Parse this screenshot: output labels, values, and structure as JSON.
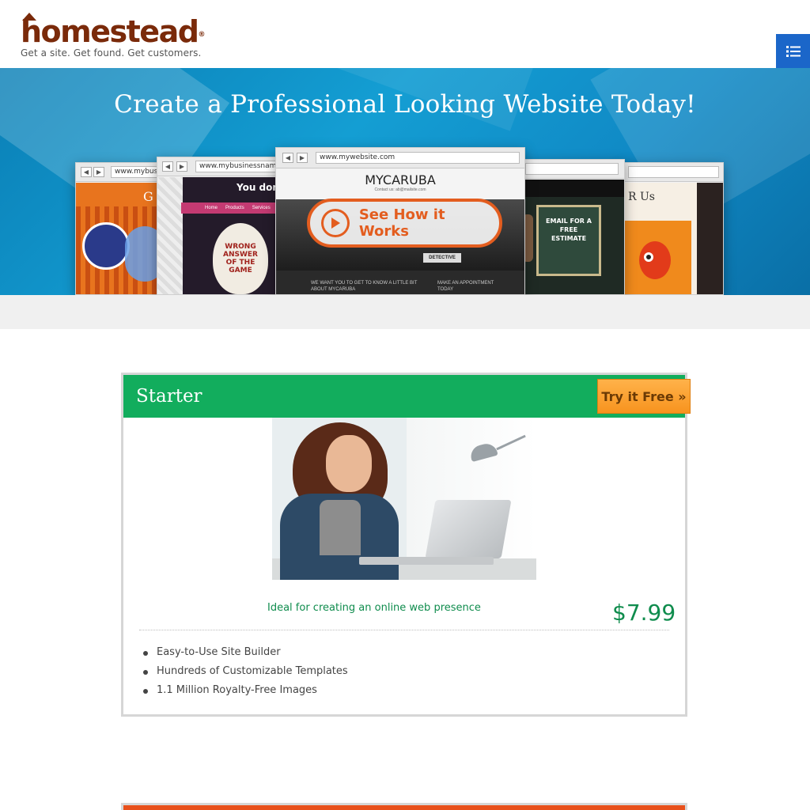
{
  "brand": {
    "name": "homestead",
    "registered": "®",
    "tagline": "Get a site.  Get found.  Get customers.",
    "color": "#7a2a0a"
  },
  "header": {
    "menu_icon": "list-icon",
    "menu_color": "#1b66c9"
  },
  "hero": {
    "title": "Create a Professional Looking Website Today!",
    "cta_label": "See How it Works",
    "cta_icon": "play-icon",
    "mockups": [
      {
        "url": "www.mybusinessname.com",
        "heading": "G"
      },
      {
        "url": "www.mybusinessname.com",
        "heading": "You don't",
        "nav": [
          "Home",
          "Products",
          "Services"
        ],
        "poster": "WRONG ANSWER OF THE GAME"
      },
      {
        "url": "www.mywebsite.com",
        "heading": "MYCARUBA",
        "sub": "Contact us: ab@mailsite.com",
        "footer_left": "WE WANT YOU TO GET TO KNOW A LITTLE BIT ABOUT MYCARUBA",
        "footer_right": "MAKE AN APPOINTMENT TODAY",
        "sign": "DETECTIVE"
      },
      {
        "url": "",
        "heading": "EMAIL FOR A FREE ESTIMATE"
      },
      {
        "url": "",
        "heading": "R Us"
      }
    ]
  },
  "plan": {
    "name": "Starter",
    "cta_label": "Try it Free »",
    "description": "Ideal for creating an online web presence",
    "price": "$7.99",
    "features": [
      "Easy-to-Use Site Builder",
      "Hundreds of Customizable Templates",
      "1.1 Million Royalty-Free Images"
    ],
    "header_color": "#12ad5d",
    "accent_color": "#0f8c4d",
    "cta_color": "#f7931e"
  },
  "next_plan": {
    "header_color": "#e8501b"
  }
}
